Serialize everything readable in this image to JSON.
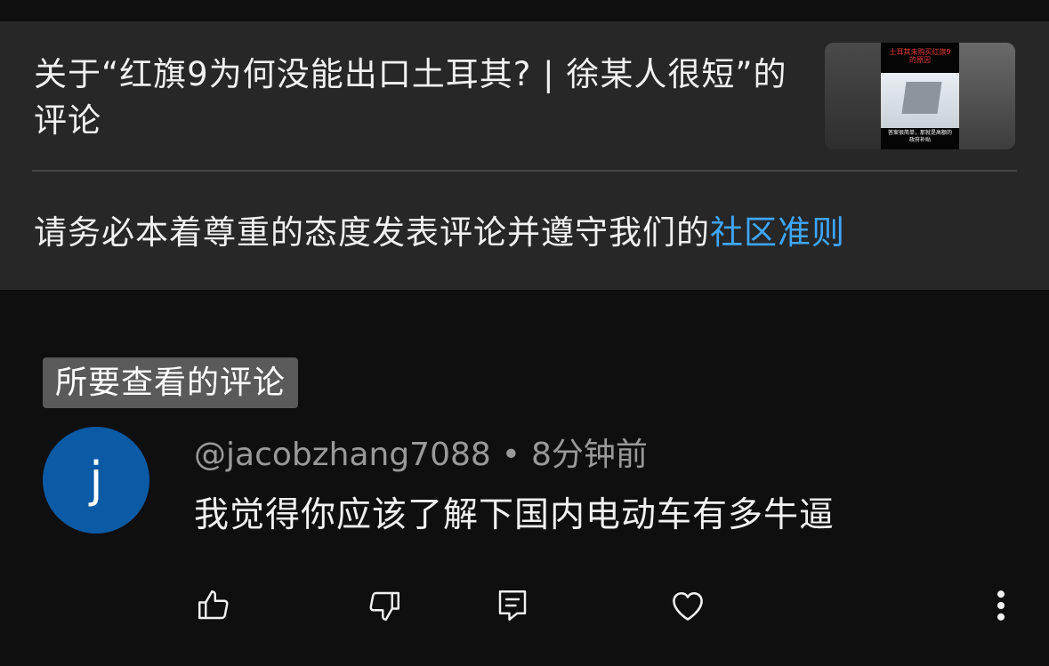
{
  "video": {
    "title": "关于“红旗9为何没能出口土耳其? | 徐某人很短”的评论",
    "thumbnail_icon": "video-thumbnail"
  },
  "thumbnail": {
    "poster_top_text": "土耳其未购买红旗9的原因",
    "poster_bottom_text": "答案很简单，那就是高额的政府补贴"
  },
  "guidelines": {
    "text": "请务必本着尊重的态度发表评论并遵守我们的",
    "link_label": "社区准则"
  },
  "highlight": {
    "label": "所要查看的评论"
  },
  "comment": {
    "avatar_letter": "j",
    "author": "@jacobzhang7088",
    "separator": "•",
    "time": "8分钟前",
    "text": "我觉得你应该了解下国内电动车有多牛逼",
    "avatar_color": "#0b5aa6"
  },
  "actions": {
    "icons": [
      "like-icon",
      "dislike-icon",
      "reply-icon",
      "heart-icon",
      "more-icon"
    ]
  },
  "colors": {
    "link": "#3ea6ff",
    "panel": "#272727",
    "background": "#0f0f0f"
  }
}
